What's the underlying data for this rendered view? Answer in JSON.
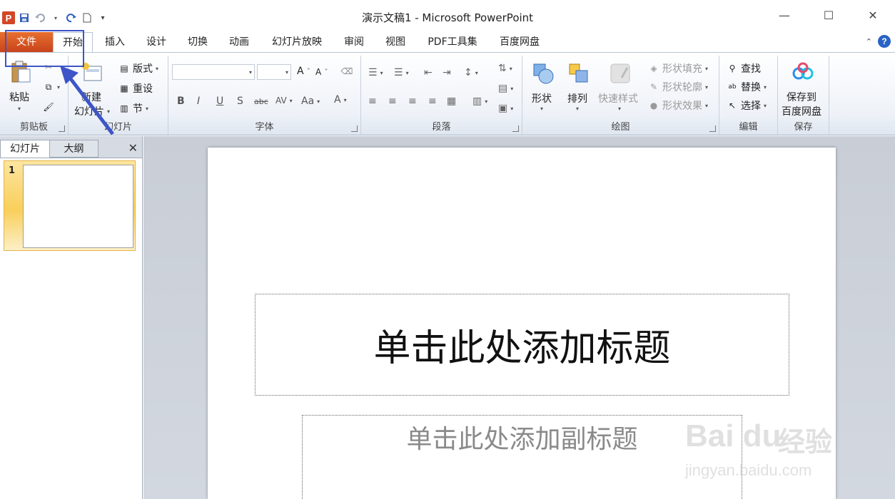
{
  "window": {
    "title": "演示文稿1 - Microsoft PowerPoint",
    "app_logo": "P"
  },
  "quick_access": {
    "icons": [
      "powerpoint-icon",
      "save-icon",
      "undo-icon",
      "redo-icon",
      "new-doc-icon",
      "customize-icon"
    ]
  },
  "tabs": [
    {
      "label": "文件"
    },
    {
      "label": "开始"
    },
    {
      "label": "插入"
    },
    {
      "label": "设计"
    },
    {
      "label": "切换"
    },
    {
      "label": "动画"
    },
    {
      "label": "幻灯片放映"
    },
    {
      "label": "审阅"
    },
    {
      "label": "视图"
    },
    {
      "label": "PDF工具集"
    },
    {
      "label": "百度网盘"
    }
  ],
  "active_tab": "开始",
  "help_label": "?",
  "ribbon": {
    "clipboard": {
      "label": "剪贴板",
      "paste": "粘贴"
    },
    "slides": {
      "label": "幻灯片",
      "new_slide_line1": "新建",
      "new_slide_line2": "幻灯片",
      "layout": "版式",
      "reset": "重设",
      "section": "节"
    },
    "font": {
      "label": "字体",
      "bold": "B",
      "italic": "I",
      "underline": "U",
      "shadow": "S",
      "strike": "abc",
      "spacing": "AV",
      "case": "Aa",
      "color": "A",
      "grow": "A",
      "shrink": "A"
    },
    "paragraph": {
      "label": "段落"
    },
    "drawing": {
      "label": "绘图",
      "shapes": "形状",
      "arrange": "排列",
      "quick_styles": "快速样式",
      "shape_fill": "形状填充",
      "shape_outline": "形状轮廓",
      "shape_effects": "形状效果"
    },
    "editing": {
      "label": "编辑",
      "find": "查找",
      "replace": "替换",
      "select": "选择"
    },
    "save": {
      "label": "保存",
      "save_line1": "保存到",
      "save_line2": "百度网盘"
    }
  },
  "left_panel": {
    "tab_slides": "幻灯片",
    "tab_outline": "大纲",
    "close": "✕",
    "slide_number": "1"
  },
  "slide": {
    "title_placeholder": "单击此处添加标题",
    "subtitle_placeholder": "单击此处添加副标题"
  },
  "watermark": {
    "logo_text": "Bai du",
    "cn_text": "经验",
    "url": "jingyan.baidu.com"
  },
  "colors": {
    "file_tab": "#d24726",
    "annotation": "#3d55c8",
    "selected_thumb": "#f9cf5b"
  }
}
